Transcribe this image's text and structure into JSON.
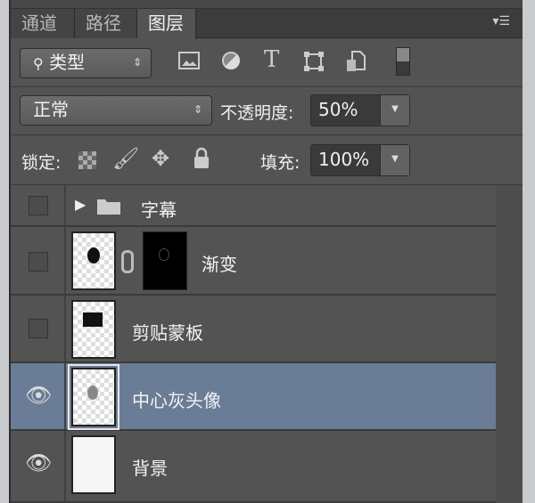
{
  "tabs": [
    {
      "label": "通道"
    },
    {
      "label": "路径"
    },
    {
      "label": "图层",
      "active": true
    }
  ],
  "filter": {
    "kind_label": "类型",
    "icons": [
      "image-filter-icon",
      "adjustment-filter-icon",
      "type-filter-icon",
      "shape-filter-icon",
      "smart-object-filter-icon",
      "filter-toggle-icon"
    ],
    "type_glyph": "T"
  },
  "blend": {
    "mode": "正常",
    "opacity_label": "不透明度:",
    "opacity": "50%"
  },
  "lock": {
    "label": "锁定:",
    "fill_label": "填充:",
    "fill": "100%"
  },
  "layers": [
    {
      "name": "字幕",
      "type": "group",
      "visible": false
    },
    {
      "name": "渐变",
      "type": "masked",
      "visible": false
    },
    {
      "name": "剪贴蒙板",
      "type": "pixel",
      "visible": false
    },
    {
      "name": "中心灰头像",
      "type": "pixel",
      "visible": true,
      "selected": true
    },
    {
      "name": "背景",
      "type": "background",
      "visible": true
    }
  ],
  "colors": {
    "panel": "#535353",
    "selected": "#6b7c97"
  }
}
